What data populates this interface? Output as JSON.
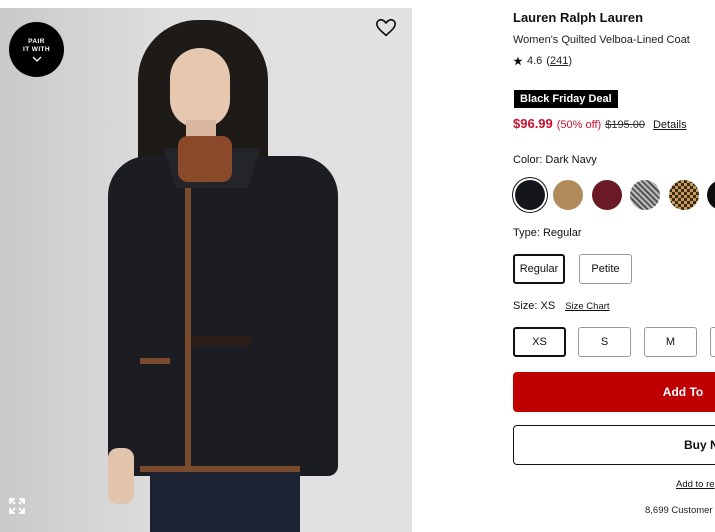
{
  "badge": {
    "line1": "PAIR",
    "line2": "IT WITH"
  },
  "product": {
    "brand": "Lauren Ralph Lauren",
    "name": "Women's Quilted Velboa-Lined Coat",
    "rating": "4.6",
    "reviews": "241"
  },
  "promo": {
    "badge": "Black Friday Deal"
  },
  "price": {
    "sale": "$96.99",
    "discount": "(50% off)",
    "original": "$195.00",
    "details_link": "Details"
  },
  "color": {
    "label": "Color: Dark Navy",
    "swatches": [
      {
        "name": "Dark Navy",
        "hex": "#14161c",
        "selected": true
      },
      {
        "name": "Camel",
        "hex": "#b08a58"
      },
      {
        "name": "Burgundy",
        "hex": "#6a1a24"
      },
      {
        "name": "Grey Tweed",
        "hex": "#8e8e8e"
      },
      {
        "name": "Houndstooth",
        "hex": "#8a6a3e"
      },
      {
        "name": "Black",
        "hex": "#0e0e0e"
      }
    ]
  },
  "type": {
    "label": "Type: Regular",
    "options": [
      {
        "label": "Regular",
        "selected": true
      },
      {
        "label": "Petite"
      }
    ]
  },
  "size": {
    "label": "Size: XS",
    "chart_link": "Size Chart",
    "options": [
      {
        "label": "XS",
        "selected": true
      },
      {
        "label": "S"
      },
      {
        "label": "M"
      },
      {
        "label": ""
      }
    ]
  },
  "actions": {
    "add_to_bag": "Add To",
    "buy_now": "Buy N",
    "add_to_registry": "Add to re",
    "customers": "8,699 Customer"
  },
  "colors": {
    "sale_red": "#c8102e",
    "cta_red": "#c00000"
  }
}
